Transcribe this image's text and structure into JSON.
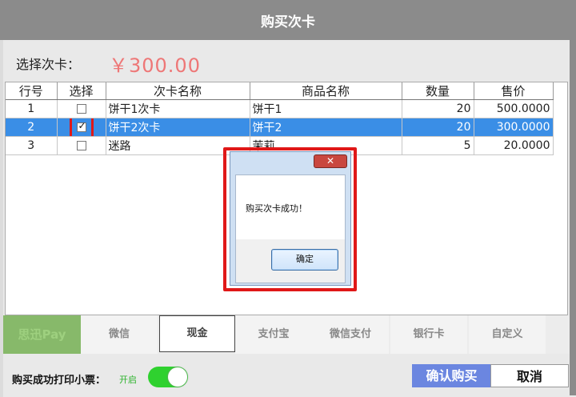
{
  "window": {
    "title": "购买次卡"
  },
  "selector": {
    "label": "选择次卡：",
    "price": "￥300.00"
  },
  "table": {
    "headers": [
      "行号",
      "选择",
      "次卡名称",
      "商品名称",
      "数量",
      "售价"
    ],
    "rows": [
      {
        "row_no": "1",
        "checked": false,
        "card_name": "饼干1次卡",
        "product_name": "饼干1",
        "qty": "20",
        "price": "500.0000"
      },
      {
        "row_no": "2",
        "checked": true,
        "card_name": "饼干2次卡",
        "product_name": "饼干2",
        "qty": "20",
        "price": "300.0000"
      },
      {
        "row_no": "3",
        "checked": false,
        "card_name": "迷路",
        "product_name": "茉莉",
        "qty": "5",
        "price": "20.0000"
      }
    ]
  },
  "dialog": {
    "close_glyph": "✕",
    "message": "购买次卡成功！",
    "ok_label": "确定"
  },
  "payments": [
    "思迅Pay",
    "微信",
    "现金",
    "支付宝",
    "微信支付",
    "银行卡",
    "自定义"
  ],
  "footer": {
    "print_label": "购买成功打印小票：",
    "toggle_state": "开启",
    "confirm_label": "确认购买",
    "cancel_label": "取消"
  },
  "colors": {
    "accent": "#3a8ee6",
    "toggle_on": "#2fd12f",
    "confirm_button": "#6b86e0",
    "highlight": "#e01818"
  }
}
